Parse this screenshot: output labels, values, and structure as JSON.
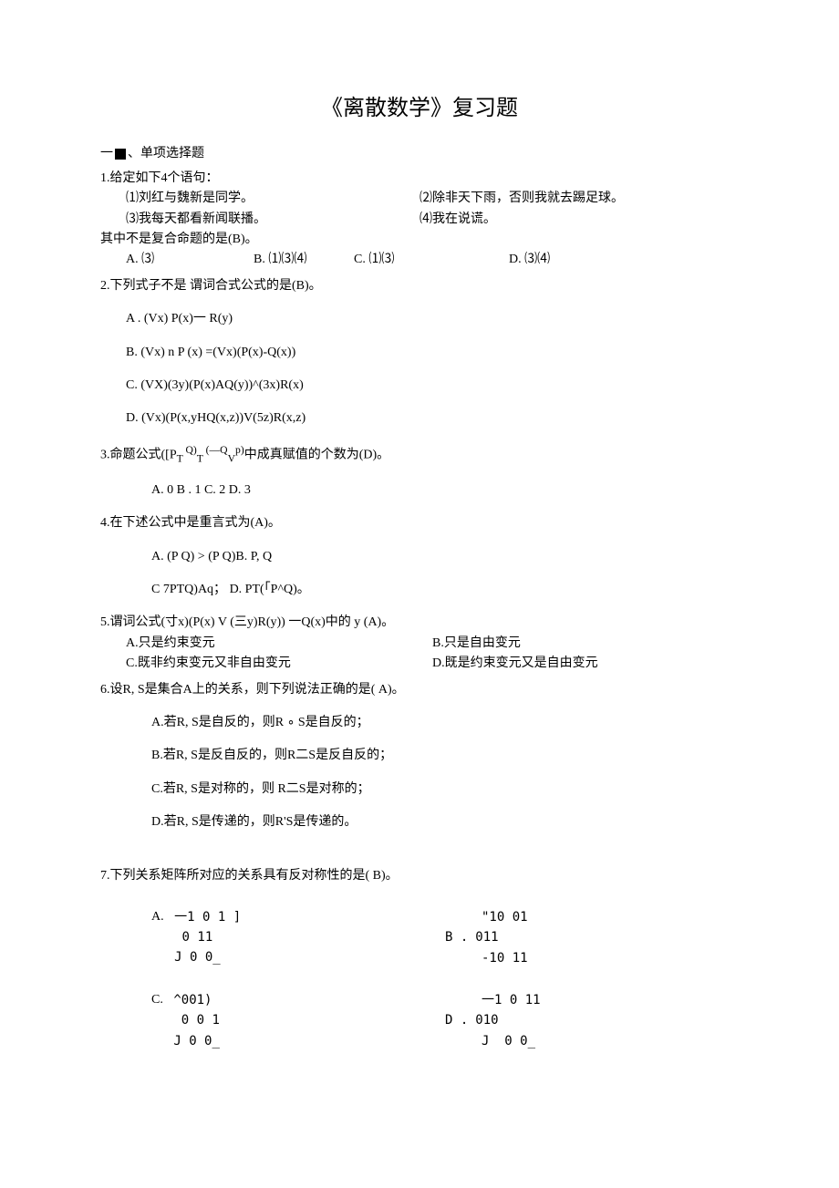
{
  "title": "《离散数学》复习题",
  "section1": "一",
  "section1_after": "、单项选择题",
  "q1": {
    "stem": "1.给定如下4个语句：",
    "s1": "⑴刘红与魏新是同学。",
    "s2": "⑵除非天下雨，否则我就去踢足球。",
    "s3": "⑶我每天都看新闻联播。",
    "s4": "⑷我在说谎。",
    "tail": "其中不是复合命题的是(B)。",
    "a": "A. ⑶",
    "b": "B. ⑴⑶⑷",
    "c": "C. ⑴⑶",
    "d": "D. ⑶⑷"
  },
  "q2": {
    "stem": "2.下列式子不是 谓词合式公式的是(B)。",
    "a": "A . (Vx) P(x)一 R(y)",
    "b": "B.  (Vx) n P (x) =(Vx)(P(x)-Q(x))",
    "c": "C.  (VX)(3y)(P(x)AQ(y))^(3x)R(x)",
    "d": "D.  (Vx)(P(x,yHQ(x,z))V(5z)R(x,z)"
  },
  "q3": {
    "stem_a": "3.命题公式([P",
    "stem_b": "T ",
    "stem_c": "Q)",
    "stem_d": "T ",
    "stem_e": "(—Q",
    "stem_f": "V",
    "stem_g": "p)",
    "stem_h": "中成真赋值的个数为(D)。",
    "opts": "A. 0 B . 1      C. 2 D. 3"
  },
  "q4": {
    "stem": "4.在下述公式中是重言式为(A)。",
    "a": "A. (P Q) > (P Q)",
    "b": "B. P, Q",
    "c": "C 7PTQ)Aq；",
    "d": "D. PT(「P^Q)。"
  },
  "q5": {
    "stem": "5.谓词公式(寸x)(P(x) V (三y)R(y)) 一Q(x)中的 y (A)。",
    "a": "A.只是约束变元",
    "b": "B.只是自由变元",
    "c": "C.既非约束变元又非自由变元",
    "d": "D.既是约束变元又是自由变元"
  },
  "q6": {
    "stem": "6.设R, S是集合A上的关系，则下列说法正确的是(      A)。",
    "a": "A.若R, S是自反的，则R ∘ S是自反的；",
    "b": "B.若R, S是反自反的，则R二S是反自反的；",
    "c": "C.若R, S是对称的，则 R二S是对称的；",
    "d": "D.若R, S是传递的，则R'S是传递的。"
  },
  "q7": {
    "stem": "7.下列关系矩阵所对应的关系具有反对称性的是( B)。",
    "a_label": "A.",
    "a_m1": "一1 0 1 ]",
    "a_m2": " 0 11",
    "a_m3": "J 0 0_",
    "b_label": "B .",
    "b_m1": "\"10 01",
    "b_m2": "011",
    "b_m3": "-10 11",
    "c_label": "C.",
    "c_m1": "^001)",
    "c_m2": " 0 0 1",
    "c_m3": "J 0 0_",
    "d_label": "D .",
    "d_m1": "一1 0 11",
    "d_m2": "010",
    "d_m3": "J  0 0_"
  }
}
